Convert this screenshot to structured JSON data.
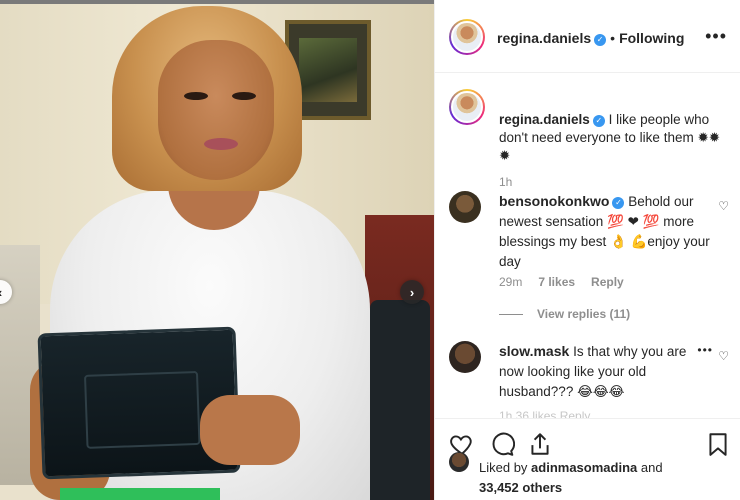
{
  "post": {
    "author": "regina.daniels",
    "follow_status": "Following",
    "separator": "•",
    "more": "•••",
    "caption_text": "I like people who don't need everyone to like them ✹✹ ✹",
    "caption_time": "1h"
  },
  "comments": [
    {
      "username": "bensonokonkwo",
      "text": "Behold our newest sensation 💯 ❤ 💯 more blessings my best 👌 💪enjoy your day",
      "time": "29m",
      "likes": "7 likes",
      "reply": "Reply",
      "view_replies": "View replies (11)"
    },
    {
      "username": "slow.mask",
      "text": "Is that why you are now looking like your old husband??? 😂😂😂",
      "more": "•••",
      "partial_meta": "1h   36 likes   Reply"
    }
  ],
  "liked_by": {
    "prefix": "Liked by",
    "user": "adinmasomadina",
    "conjunction": "and",
    "others": "33,452 others"
  },
  "icons": {
    "like": "heart-icon",
    "comment": "comment-icon",
    "share": "share-icon",
    "save": "bookmark-icon",
    "verified": "verified-badge-icon"
  },
  "colors": {
    "verified_blue": "#3897f0",
    "muted_text": "#8e8e8e",
    "primary_text": "#262626"
  }
}
